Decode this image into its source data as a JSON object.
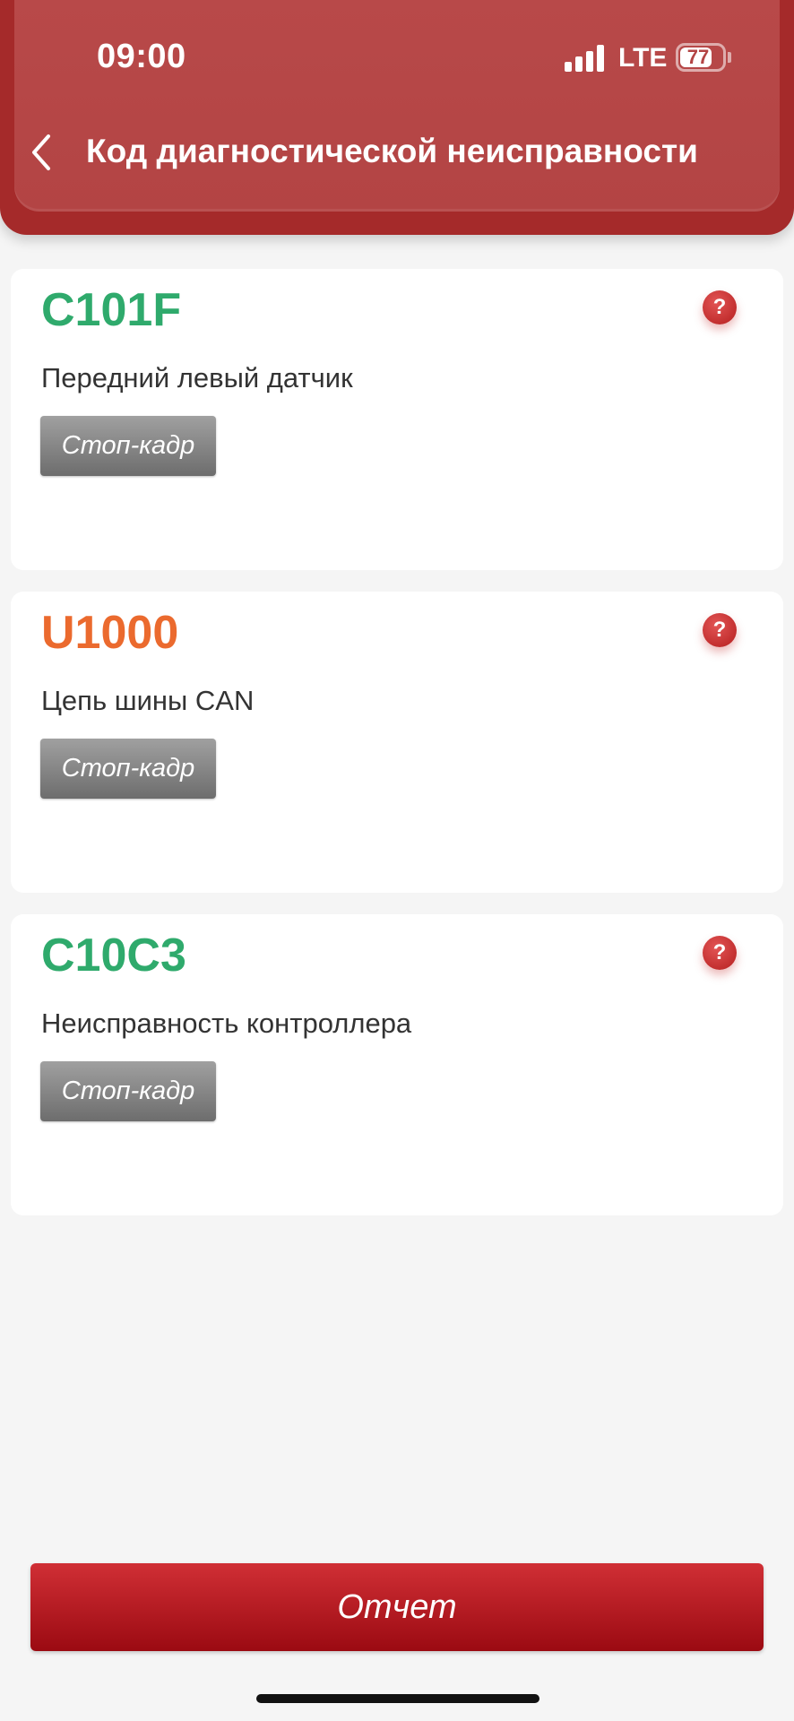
{
  "status_bar": {
    "time": "09:00",
    "network": "LTE",
    "battery": "77",
    "battery_level_percent": 77
  },
  "header": {
    "title": "Код диагностической неисправности"
  },
  "dtcs": [
    {
      "code": "C101F",
      "description": "Передний левый датчик",
      "freeze_frame_label": "Стоп-кадр",
      "code_color": "#2faa6c"
    },
    {
      "code": "U1000",
      "description": "Цепь шины CAN",
      "freeze_frame_label": "Стоп-кадр",
      "code_color": "#eb6a2e"
    },
    {
      "code": "C10C3",
      "description": "Неисправность контроллера",
      "freeze_frame_label": "Стоп-кадр",
      "code_color": "#2faa6c"
    }
  ],
  "icons": {
    "help": "?",
    "back": "chevron-left-icon"
  },
  "footer": {
    "report_label": "Отчет"
  },
  "colors": {
    "header": "#b34444",
    "accent_red": "#b51f1f",
    "report_button": "#b8161d"
  }
}
